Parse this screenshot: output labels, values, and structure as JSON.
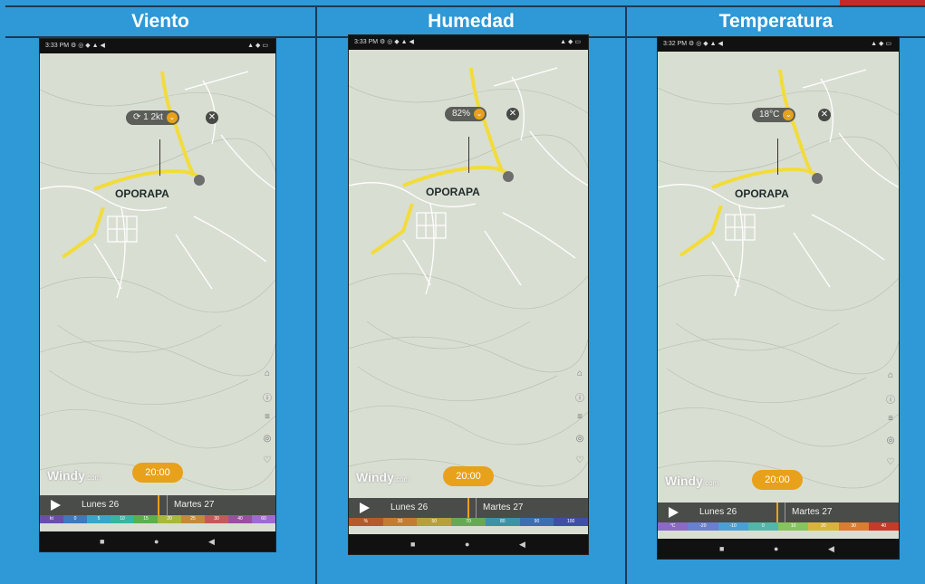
{
  "columns": [
    {
      "title": "Viento",
      "status": {
        "time": "3:33 PM",
        "icons_left": "⚙ ◎ ◆ ▲ ◀",
        "icons_right": "▲ ◆ ▭"
      },
      "town": "OPORAPA",
      "reading": "⟳ 1 2kt",
      "time_bubble": "20:00",
      "days": [
        "Lunes 26",
        "Martes 27"
      ],
      "logo": "Windy",
      "logo_suffix": ".com",
      "scale_labels": [
        "kt",
        "0",
        "5",
        "10",
        "15",
        "20",
        "25",
        "30",
        "40",
        "60"
      ],
      "scale_colors": [
        "#6b4ea8",
        "#3f79b9",
        "#39a6c9",
        "#38b5a0",
        "#5bb04c",
        "#a9b83b",
        "#c48a3a",
        "#c35a5a",
        "#9b4fa0",
        "#a06ad0"
      ]
    },
    {
      "title": "Humedad",
      "status": {
        "time": "3:33 PM",
        "icons_left": "⚙ ◎ ◆ ▲ ◀",
        "icons_right": "▲ ◆ ▭"
      },
      "town": "OPORAPA",
      "reading": "82%",
      "time_bubble": "20:00",
      "days": [
        "Lunes 26",
        "Martes 27"
      ],
      "logo": "Windy",
      "logo_suffix": ".com",
      "scale_labels": [
        "%",
        "30",
        "50",
        "70",
        "80",
        "90",
        "100"
      ],
      "scale_colors": [
        "#b45a2b",
        "#c47c30",
        "#b3a23a",
        "#6aa65a",
        "#3c93a8",
        "#3b6fb4",
        "#3e4fa6"
      ]
    },
    {
      "title": "Temperatura",
      "status": {
        "time": "3:32 PM",
        "icons_left": "⚙ ◎ ◆ ▲ ◀",
        "icons_right": "▲ ◆ ▭"
      },
      "town": "OPORAPA",
      "reading": "18°C",
      "time_bubble": "20:00",
      "days": [
        "Lunes 26",
        "Martes 27"
      ],
      "logo": "Windy",
      "logo_suffix": ".com",
      "scale_labels": [
        "°C",
        "-20",
        "-10",
        "0",
        "10",
        "20",
        "30",
        "40"
      ],
      "scale_colors": [
        "#8a6ac4",
        "#6a7fd0",
        "#4aa0d4",
        "#52b7a8",
        "#88c45c",
        "#d9b43a",
        "#dc7c2e",
        "#c73a2a"
      ]
    }
  ],
  "nav_icons": [
    "stop-icon",
    "home-icon",
    "back-icon"
  ],
  "colors": {
    "background": "#2f98d6",
    "accent": "#e8a11a",
    "map": "#d9ded2",
    "road": "#f2dc3c"
  }
}
